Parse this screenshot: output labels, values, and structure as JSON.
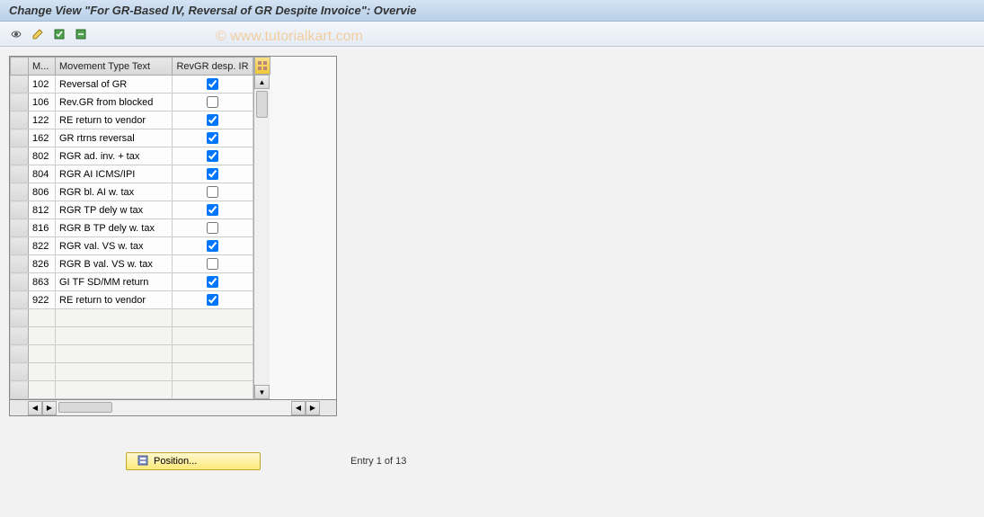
{
  "title": "Change View \"For GR-Based IV, Reversal of GR Despite Invoice\": Overvie",
  "watermark": "© www.tutorialkart.com",
  "table": {
    "headers": {
      "code": "M...",
      "text": "Movement Type Text",
      "check": "RevGR desp. IR"
    },
    "rows": [
      {
        "code": "102",
        "text": "Reversal of GR",
        "check": true
      },
      {
        "code": "106",
        "text": "Rev.GR from blocked",
        "check": false
      },
      {
        "code": "122",
        "text": "RE return to vendor",
        "check": true
      },
      {
        "code": "162",
        "text": "GR rtrns reversal",
        "check": true
      },
      {
        "code": "802",
        "text": "RGR ad. inv. + tax",
        "check": true
      },
      {
        "code": "804",
        "text": "RGR AI ICMS/IPI",
        "check": true
      },
      {
        "code": "806",
        "text": "RGR bl. AI w. tax",
        "check": false
      },
      {
        "code": "812",
        "text": "RGR TP dely w tax",
        "check": true
      },
      {
        "code": "816",
        "text": "RGR B TP dely w. tax",
        "check": false
      },
      {
        "code": "822",
        "text": "RGR val. VS w. tax",
        "check": true
      },
      {
        "code": "826",
        "text": "RGR B val. VS w. tax",
        "check": false
      },
      {
        "code": "863",
        "text": "GI TF SD/MM return",
        "check": true
      },
      {
        "code": "922",
        "text": "RE return to vendor",
        "check": true
      }
    ]
  },
  "footer": {
    "position_label": "Position...",
    "entry_text": "Entry 1 of 13"
  }
}
